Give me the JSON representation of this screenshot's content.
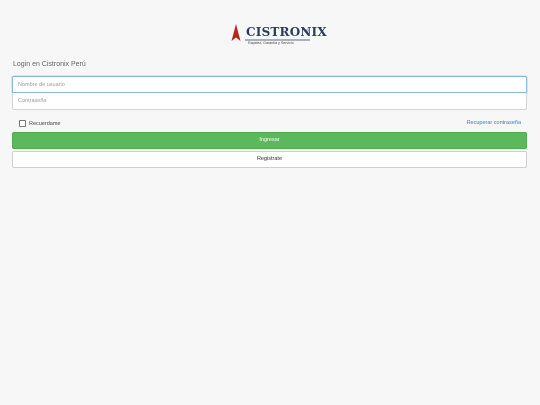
{
  "brand": {
    "name": "CISTRONIX",
    "tagline": "Rapidez, Garantía y Servicio",
    "accent_color": "#b5281c",
    "name_color": "#2a3b5e",
    "logo_icon": "red-triangle-peak-icon"
  },
  "login": {
    "title": "Login en Cistronix Perú",
    "username_placeholder": "Nombre de usuario",
    "password_placeholder": "Contraseña",
    "remember_label": "Recuerdame",
    "recover_link": "Recuperar contraseña",
    "login_button": "Ingresar",
    "register_button": "Registrate"
  },
  "colors": {
    "primary_green": "#5cb85c",
    "link_blue": "#3a7bc8",
    "background": "#f7f7f7"
  }
}
